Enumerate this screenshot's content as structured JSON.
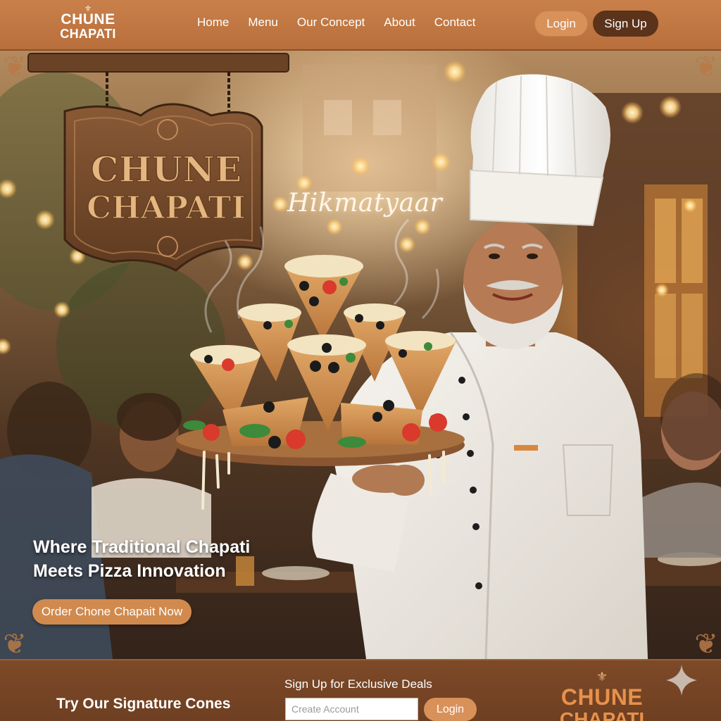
{
  "brand": {
    "crown_glyph": "⚜",
    "name_line1": "CHUNE",
    "name_line2": "CHAPATI"
  },
  "nav": {
    "items": [
      {
        "label": "Home"
      },
      {
        "label": "Menu"
      },
      {
        "label": "Our Concept"
      },
      {
        "label": "About"
      },
      {
        "label": "Contact"
      }
    ],
    "login_label": "Login",
    "signup_label": "Sign Up"
  },
  "hero": {
    "sign_line1": "CHUNE",
    "sign_line2": "CHAPATI",
    "script_text": "Hikmatyaar",
    "tagline_line1": "Where Traditional Chapati",
    "tagline_line2": "Meets Pizza Innovation",
    "cta_label": "Order Chone Chapait Now"
  },
  "footer": {
    "title": "Try Our Signature Cones",
    "deals_heading": "Sign Up for Exclusive Deals",
    "input_placeholder": "Create Account",
    "login_label": "Login",
    "logo_line1": "CHUNE",
    "logo_line2": "CHAPATI"
  },
  "colors": {
    "header_bg": "#c27945",
    "accent_button": "#d9915a",
    "dark_button": "#5b321a",
    "footer_bg": "#764525",
    "logo_orange": "#e8914a"
  },
  "icons": {
    "corner_ornament": "ornament-icon",
    "sparkle": "sparkle-icon",
    "crown": "fleur-de-lis-icon"
  }
}
